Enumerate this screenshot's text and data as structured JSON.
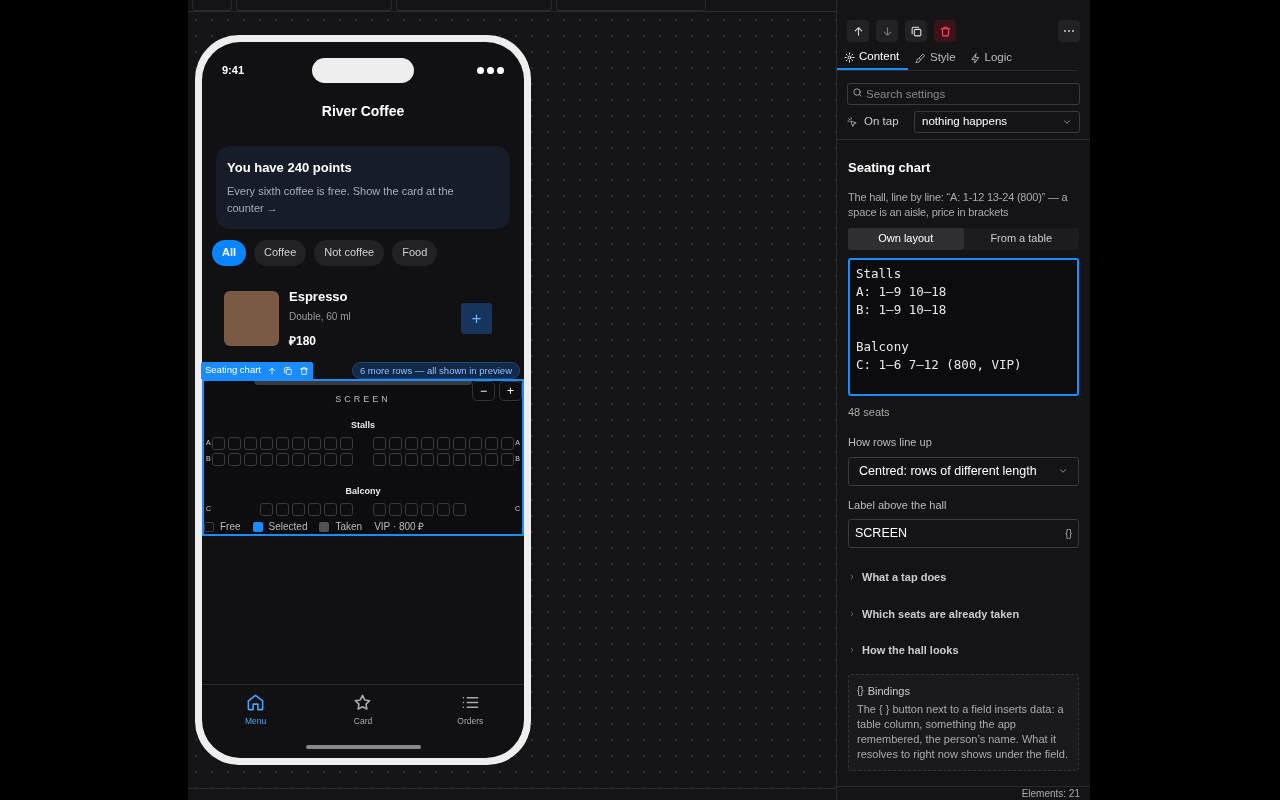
{
  "phone": {
    "time": "9:41",
    "title": "River Coffee",
    "points_card": {
      "title": "You have 240 points",
      "text": "Every sixth coffee is free. Show the card at the counter →"
    },
    "chips": [
      {
        "label": "All",
        "selected": true
      },
      {
        "label": "Coffee",
        "selected": false
      },
      {
        "label": "Not coffee",
        "selected": false
      },
      {
        "label": "Food",
        "selected": false
      }
    ],
    "product": {
      "name": "Espresso",
      "detail": "Double, 60 ml",
      "price": "₽180",
      "add": "+"
    },
    "selection_tag": {
      "label": "Seating chart"
    },
    "more_rows": "6 more rows — all shown in preview",
    "seating": {
      "screen_label": "SCREEN",
      "zoom_out": "−",
      "zoom_in": "+",
      "sections": [
        {
          "name": "Stalls",
          "rows": [
            {
              "label_left": "A",
              "label_right": "A",
              "blocks": [
                {
                  "seats": [
                    {
                      "taken": false
                    },
                    {
                      "taken": false
                    },
                    {
                      "taken": false
                    },
                    {
                      "taken": false
                    },
                    {
                      "taken": false
                    },
                    {
                      "taken": false
                    },
                    {
                      "taken": false
                    },
                    {
                      "taken": false
                    },
                    {
                      "taken": false
                    }
                  ]
                },
                {
                  "seats": [
                    {
                      "taken": false
                    },
                    {
                      "taken": false
                    },
                    {
                      "taken": false
                    },
                    {
                      "taken": false
                    },
                    {
                      "taken": false
                    },
                    {
                      "taken": false
                    },
                    {
                      "taken": false
                    },
                    {
                      "taken": false
                    },
                    {
                      "taken": false
                    }
                  ]
                }
              ]
            },
            {
              "label_left": "B",
              "label_right": "B",
              "blocks": [
                {
                  "seats": [
                    {
                      "taken": false
                    },
                    {
                      "taken": false
                    },
                    {
                      "taken": false
                    },
                    {
                      "taken": false
                    },
                    {
                      "taken": false
                    },
                    {
                      "taken": false
                    },
                    {
                      "taken": false
                    },
                    {
                      "taken": false
                    },
                    {
                      "taken": false
                    }
                  ]
                },
                {
                  "seats": [
                    {
                      "taken": false
                    },
                    {
                      "taken": false
                    },
                    {
                      "taken": false
                    },
                    {
                      "taken": false
                    },
                    {
                      "taken": false
                    },
                    {
                      "taken": false
                    },
                    {
                      "taken": false
                    },
                    {
                      "taken": false
                    },
                    {
                      "taken": false
                    }
                  ]
                }
              ]
            }
          ]
        },
        {
          "name": "Balcony",
          "rows": [
            {
              "label_left": "C",
              "label_right": "C",
              "blocks": [
                {
                  "seats": [
                    {
                      "taken": false
                    },
                    {
                      "taken": false
                    },
                    {
                      "taken": false
                    },
                    {
                      "taken": false
                    },
                    {
                      "taken": false
                    },
                    {
                      "taken": false
                    }
                  ]
                },
                {
                  "seats": [
                    {
                      "taken": false
                    },
                    {
                      "taken": false
                    },
                    {
                      "taken": false
                    },
                    {
                      "taken": false
                    },
                    {
                      "taken": false
                    },
                    {
                      "taken": false
                    }
                  ]
                }
              ]
            }
          ]
        }
      ],
      "legend": [
        {
          "kind": "free",
          "label": "Free"
        },
        {
          "kind": "selected",
          "label": "Selected"
        },
        {
          "kind": "taken",
          "label": "Taken"
        },
        {
          "kind": "vip",
          "label": "VIP · 800 ₽"
        }
      ]
    },
    "nav": [
      {
        "label": "Menu",
        "selected": true
      },
      {
        "label": "Card",
        "selected": false
      },
      {
        "label": "Orders",
        "selected": false
      }
    ]
  },
  "panel": {
    "tabs": [
      {
        "label": "Content",
        "selected": true
      },
      {
        "label": "Style",
        "selected": false
      },
      {
        "label": "Logic",
        "selected": false
      }
    ],
    "search": {
      "placeholder": "Search settings"
    },
    "on_tap": {
      "label": "On tap",
      "value": "nothing happens"
    },
    "heading": "Seating chart",
    "description": "The hall, line by line: “A: 1-12 13-24 (800)” — a space is an aisle, price in brackets",
    "modes": [
      {
        "label": "Own layout",
        "selected": true
      },
      {
        "label": "From a table",
        "selected": false
      }
    ],
    "layout_text": "Stalls\nA: 1–9 10–18\nB: 1–9 10–18\n\nBalcony\nC: 1–6 7–12 (800, VIP)",
    "seat_count": "48 seats",
    "align": {
      "label": "How rows line up",
      "value": "Centred: rows of different length"
    },
    "hall_label": {
      "label": "Label above the hall",
      "value": "SCREEN",
      "binding": "{}"
    },
    "accordions": [
      {
        "label": "What a tap does",
        "expanded": false
      },
      {
        "label": "Which seats are already taken",
        "expanded": false
      },
      {
        "label": "How the hall looks",
        "expanded": false
      }
    ],
    "bindings": {
      "title": "Bindings",
      "icon": "{}",
      "text": "The { } button next to a field inserts data: a table column, something the app remembered, the person’s name. What it resolves to right now shows under the field."
    }
  },
  "status_bar": {
    "elements": "Elements: 21"
  }
}
